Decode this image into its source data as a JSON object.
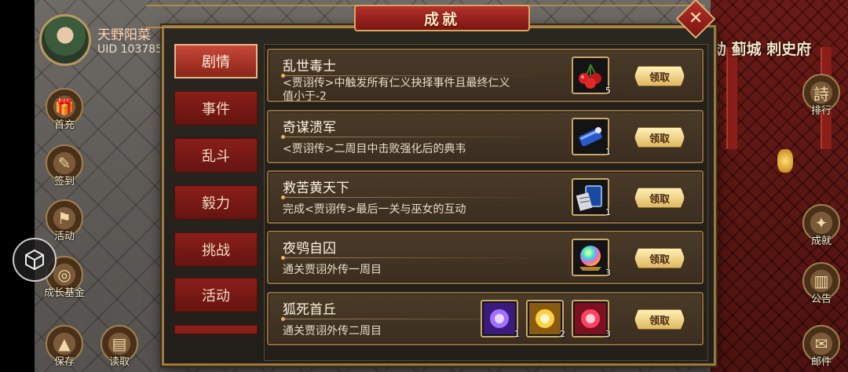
{
  "player": {
    "name": "天野阳菜",
    "uid": "UID  103785"
  },
  "left_menu": [
    {
      "label": "首充",
      "icon": "gift-icon"
    },
    {
      "label": "签到",
      "icon": "calendar-icon"
    },
    {
      "label": "活动",
      "icon": "flag-icon"
    },
    {
      "label": "成长基金",
      "icon": "coin-icon"
    },
    {
      "label": "保存",
      "icon": "save-icon"
    },
    {
      "label": "读取",
      "icon": "load-icon"
    }
  ],
  "right_menu": [
    {
      "label": "排行",
      "icon": "ranking-icon"
    },
    {
      "label": "成就",
      "icon": "achievement-icon"
    },
    {
      "label": "公告",
      "icon": "scroll-icon"
    },
    {
      "label": "邮件",
      "icon": "mail-icon"
    }
  ],
  "city_labels": "劫 蓟城   刺史府",
  "modal": {
    "title": "成就",
    "close_symbol": "✕",
    "tabs": [
      {
        "label": "剧情",
        "active": true
      },
      {
        "label": "事件",
        "active": false
      },
      {
        "label": "乱斗",
        "active": false
      },
      {
        "label": "毅力",
        "active": false
      },
      {
        "label": "挑战",
        "active": false
      },
      {
        "label": "活动",
        "active": false
      }
    ],
    "claim_label": "领取",
    "achievements": [
      {
        "title": "乱世毒士",
        "desc": "<贾诩传>中触发所有仁义抉择事件且最终仁义值小于-2",
        "rewards": [
          {
            "icon": "cherry-icon",
            "count": "5"
          }
        ]
      },
      {
        "title": "奇谋溃军",
        "desc": "<贾诩传>二周目中击败强化后的典韦",
        "rewards": [
          {
            "icon": "scroll-item-icon",
            "count": "1"
          }
        ]
      },
      {
        "title": "救苦黄天下",
        "desc": "完成<贾诩传>最后一关与巫女的互动",
        "rewards": [
          {
            "icon": "book-item-icon",
            "count": "1"
          }
        ]
      },
      {
        "title": "夜鸮自囚",
        "desc": "通关贾诩外传一周目",
        "rewards": [
          {
            "icon": "rainbow-orb-icon",
            "count": "3"
          }
        ]
      },
      {
        "title": "狐死首丘",
        "desc": "通关贾诩外传二周目",
        "rewards": [
          {
            "icon": "purple-gem-icon",
            "count": "1"
          },
          {
            "icon": "gold-gem-icon",
            "count": "2"
          },
          {
            "icon": "red-gem-icon",
            "count": "3"
          }
        ]
      }
    ]
  }
}
